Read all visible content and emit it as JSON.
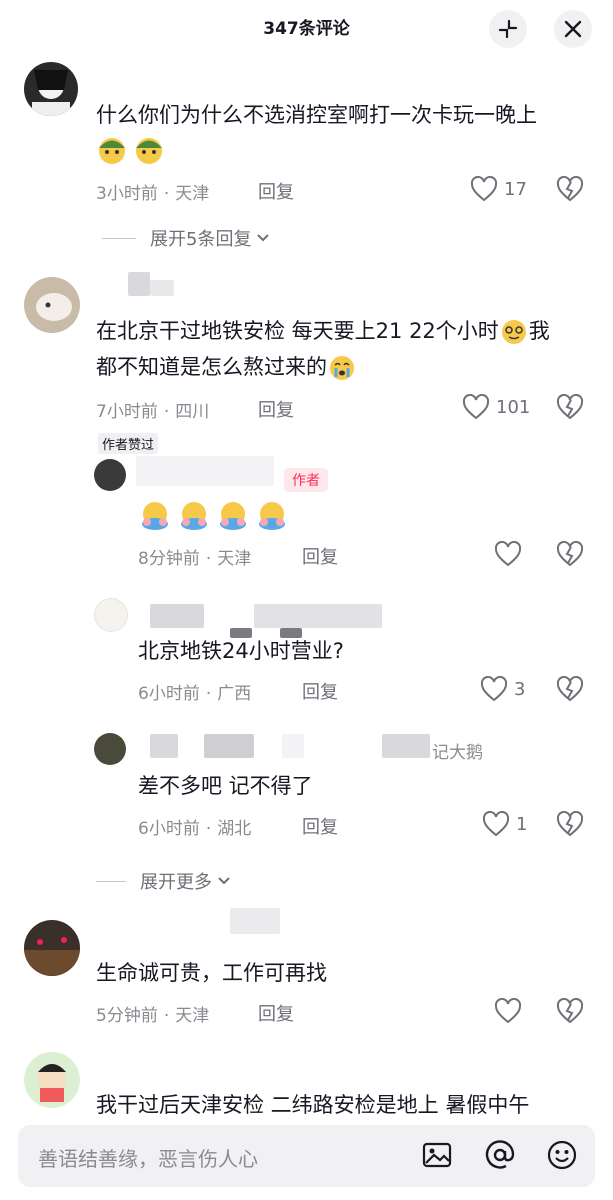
{
  "header": {
    "title": "347条评论"
  },
  "comments": [
    {
      "text_line1": "什么你们为什么不选消控室啊打一次卡玩一晚上",
      "time": "3小时前",
      "location": "天津",
      "reply": "回复",
      "likes": "17",
      "expand": "展开5条回复"
    },
    {
      "text_line1": "在北京干过地铁安检 每天要上21 22个小时",
      "text_line1_end": "我",
      "text_line2": "都不知道是怎么熬过来的",
      "time": "7小时前",
      "location": "四川",
      "reply": "回复",
      "likes": "101",
      "author_liked": "作者赞过",
      "replies": [
        {
          "badge": "作者",
          "time": "8分钟前",
          "location": "天津",
          "reply": "回复"
        },
        {
          "text": "北京地铁24小时营业?",
          "time": "6小时前",
          "location": "广西",
          "reply": "回复",
          "likes": "3"
        },
        {
          "name_suffix": "记大鹅",
          "text": "差不多吧 记不得了",
          "time": "6小时前",
          "location": "湖北",
          "reply": "回复",
          "likes": "1"
        }
      ],
      "expand": "展开更多"
    },
    {
      "text_line1": "生命诚可贵，工作可再找",
      "time": "5分钟前",
      "location": "天津",
      "reply": "回复"
    },
    {
      "text_line1": "我干过后天津安检 二纬路安检是地上 暑假中午"
    }
  ],
  "input": {
    "placeholder": "善语结善缘，恶言伤人心"
  },
  "colors": {
    "accent": "#fe2c55",
    "text": "#161823",
    "muted": "#8a8b91"
  }
}
